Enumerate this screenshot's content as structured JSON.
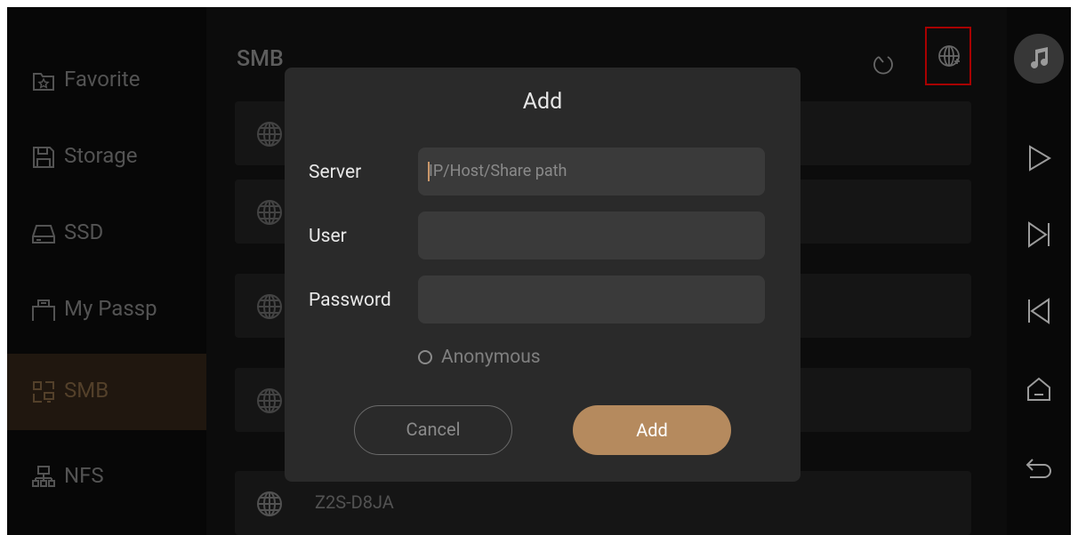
{
  "sidebar": {
    "items": [
      {
        "label": "Favorite",
        "icon": "favorite-folder-icon"
      },
      {
        "label": "Storage",
        "icon": "storage-icon"
      },
      {
        "label": "SSD",
        "icon": "ssd-icon"
      },
      {
        "label": "My Passp",
        "icon": "passport-drive-icon"
      },
      {
        "label": "SMB",
        "icon": "smb-icon",
        "active": true
      },
      {
        "label": "NFS",
        "icon": "nfs-icon"
      }
    ]
  },
  "main": {
    "title": "SMB",
    "visible_row_label": "Z2S-D8JA"
  },
  "dialog": {
    "title": "Add",
    "server_label": "Server",
    "server_placeholder": "IP/Host/Share path",
    "user_label": "User",
    "password_label": "Password",
    "anonymous_label": "Anonymous",
    "cancel_label": "Cancel",
    "add_label": "Add"
  },
  "colors": {
    "accent": "#b58a5e",
    "highlight_box": "#e00000"
  }
}
